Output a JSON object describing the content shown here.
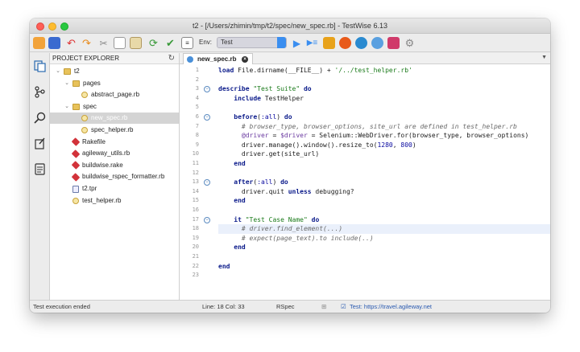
{
  "window": {
    "title": "t2 - [/Users/zhimin/tmp/t2/spec/new_spec.rb] - TestWise 6.13"
  },
  "toolbar": {
    "env_label": "Env:",
    "env_value": "Test",
    "icons": [
      "new-file-icon",
      "save-icon",
      "undo-icon",
      "redo-icon",
      "cut-icon",
      "copy-icon",
      "paste-icon",
      "refresh-icon",
      "check-icon",
      "format-icon",
      "run-icon",
      "run-all-icon",
      "chrome-icon",
      "firefox-icon",
      "edge-icon",
      "safari-icon",
      "report-icon",
      "settings-icon"
    ]
  },
  "sidebar": {
    "icons": [
      "files-icon",
      "git-icon",
      "search-icon",
      "tools-icon",
      "notes-icon"
    ]
  },
  "explorer": {
    "title": "PROJECT EXPLORER",
    "items": [
      {
        "label": "t2",
        "type": "folder",
        "depth": 0,
        "expanded": true
      },
      {
        "label": "pages",
        "type": "folder",
        "depth": 1,
        "expanded": true
      },
      {
        "label": "abstract_page.rb",
        "type": "rb",
        "depth": 2
      },
      {
        "label": "spec",
        "type": "folder",
        "depth": 1,
        "expanded": true
      },
      {
        "label": "new_spec.rb",
        "type": "rb",
        "depth": 2,
        "selected": true
      },
      {
        "label": "spec_helper.rb",
        "type": "rb",
        "depth": 2
      },
      {
        "label": "Rakefile",
        "type": "ruby",
        "depth": 1
      },
      {
        "label": "agileway_utils.rb",
        "type": "ruby",
        "depth": 1
      },
      {
        "label": "buildwise.rake",
        "type": "ruby",
        "depth": 1
      },
      {
        "label": "buildwise_rspec_formatter.rb",
        "type": "ruby",
        "depth": 1
      },
      {
        "label": "t2.tpr",
        "type": "tpr",
        "depth": 1
      },
      {
        "label": "test_helper.rb",
        "type": "rb",
        "depth": 1
      }
    ]
  },
  "editor": {
    "tab_label": "new_spec.rb",
    "highlighted_line": 18,
    "lines": [
      "load File.dirname(__FILE__) + '/../test_helper.rb'",
      "",
      "describe \"Test Suite\" do",
      "    include TestHelper",
      "",
      "    before(:all) do",
      "      # browser_type, browser_options, site_url are defined in test_helper.rb",
      "      @driver = $driver = Selenium::WebDriver.for(browser_type, browser_options)",
      "      driver.manage().window().resize_to(1280, 800)",
      "      driver.get(site_url)",
      "    end",
      "",
      "    after(:all) do",
      "      driver.quit unless debugging?",
      "    end",
      "",
      "    it \"Test Case Name\" do",
      "      # driver.find_element(...)",
      "      # expect(page_text).to include(..)",
      "    end",
      "",
      "end",
      ""
    ]
  },
  "status": {
    "message": "Test execution ended",
    "position": "Line: 18  Col: 33",
    "mode": "RSpec",
    "url": "Test: https://travel.agileway.net"
  }
}
